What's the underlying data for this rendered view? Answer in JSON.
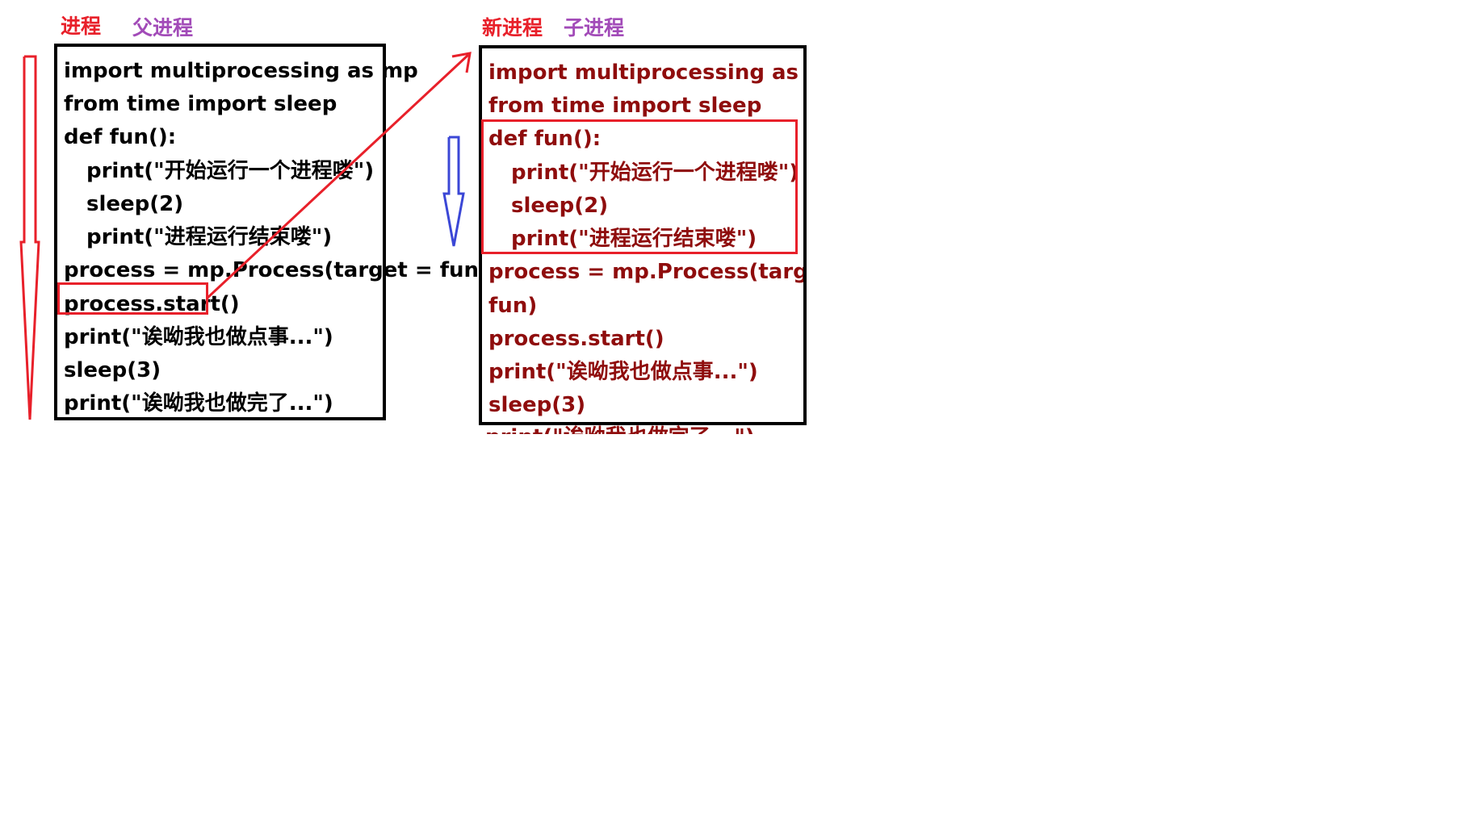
{
  "labels": {
    "parent_process": "进程",
    "parent_process_sub": "父进程",
    "child_process": "新进程",
    "child_process_sub": "子进程"
  },
  "parent_code": [
    "import multiprocessing as mp",
    "from time import sleep",
    "def fun():",
    "print(\"开始运行一个进程喽\")",
    "sleep(2)",
    "print(\"进程运行结束喽\")",
    "process = mp.Process(target = fun)",
    "process.start()",
    "print(\"诶呦我也做点事...\")",
    "sleep(3)",
    "print(\"诶呦我也做完了...\")"
  ],
  "child_code": [
    "import multiprocessing as mp",
    "from time import sleep",
    "def fun():",
    "print(\"开始运行一个进程喽\")",
    "sleep(2)",
    "print(\"进程运行结束喽\")",
    "process = mp.Process(target =",
    "fun)",
    "process.start()",
    "print(\"诶呦我也做点事...\")",
    "sleep(3)",
    "print(\"诶呦我也做完了...\")"
  ],
  "colors": {
    "red": "#e8202a",
    "purple": "#a24bb8",
    "blue": "#3b47d6",
    "dark_red_code": "#8f0d0d"
  }
}
